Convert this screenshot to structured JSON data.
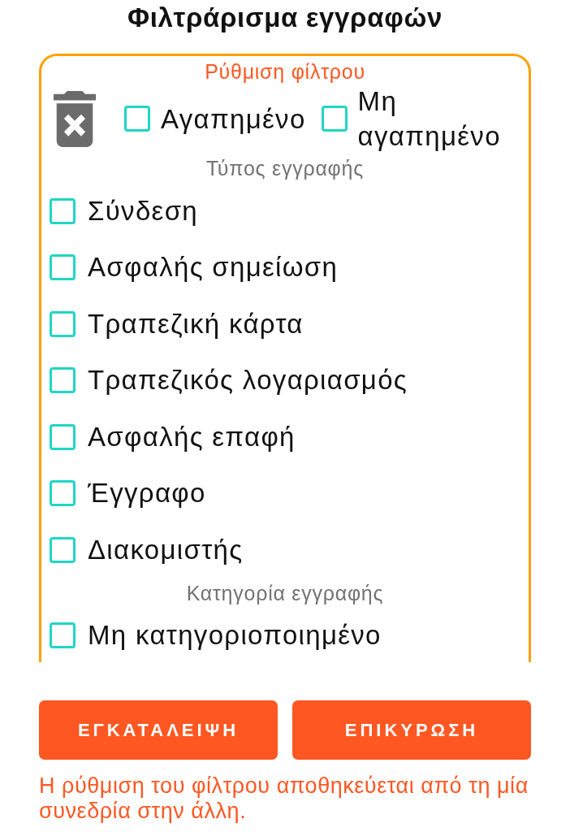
{
  "title": "Φιλτράρισμα εγγραφών",
  "filter_panel": {
    "legend": "Ρύθμιση φίλτρου",
    "favorites": [
      {
        "label": "Αγαπημένο",
        "checked": false
      },
      {
        "label": "Μη αγαπημένο",
        "checked": false
      }
    ],
    "sections": [
      {
        "heading": "Τύπος εγγραφής",
        "options": [
          {
            "label": "Σύνδεση",
            "checked": false
          },
          {
            "label": "Ασφαλής σημείωση",
            "checked": false
          },
          {
            "label": "Τραπεζική κάρτα",
            "checked": false
          },
          {
            "label": "Τραπεζικός λογαριασμός",
            "checked": false
          },
          {
            "label": "Ασφαλής επαφή",
            "checked": false
          },
          {
            "label": "Έγγραφο",
            "checked": false
          },
          {
            "label": "Διακομιστής",
            "checked": false
          }
        ]
      },
      {
        "heading": "Κατηγορία εγγραφής",
        "options": [
          {
            "label": "Μη κατηγοριοποιημένο",
            "checked": false
          }
        ]
      }
    ]
  },
  "buttons": [
    {
      "label": "ΕΓΚΑΤΑΛΕΙΨΗ"
    },
    {
      "label": "ΕΠΙΚΥΡΩΣΗ"
    }
  ],
  "note": "Η ρύθμιση του φίλτρου αποθηκεύεται από τη μία συνεδρία στην άλλη."
}
